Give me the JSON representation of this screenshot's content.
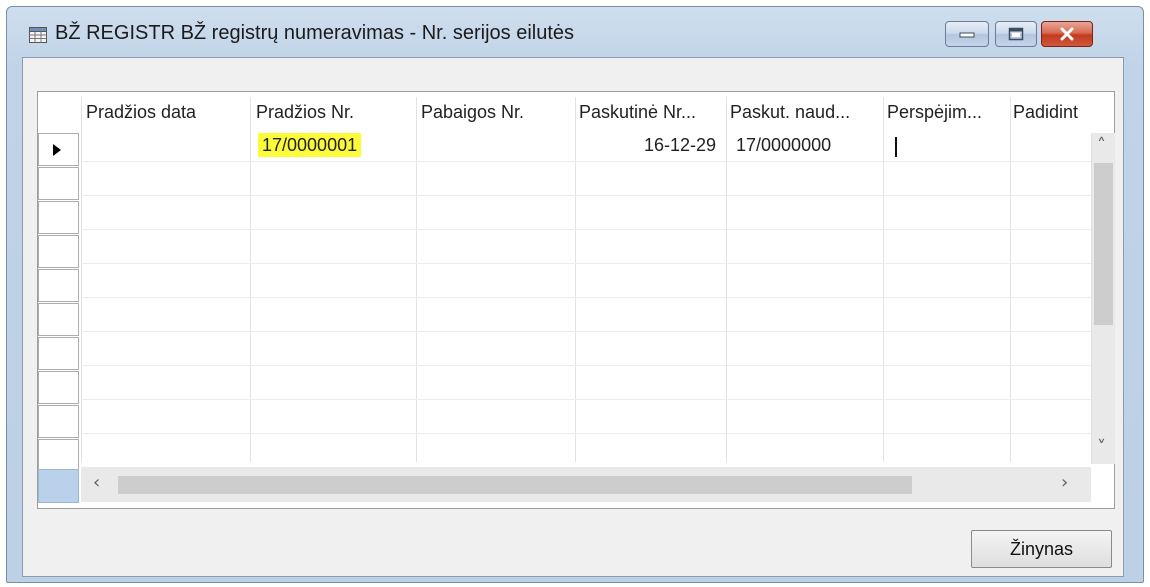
{
  "window": {
    "title": "BŽ REGISTR BŽ registrų numeravimas - Nr. serijos eilutės",
    "controls": {
      "minimize": "minimize",
      "maximize": "maximize",
      "close": "close"
    }
  },
  "table": {
    "columns": [
      "Pradžios data",
      "Pradžios Nr.",
      "Pabaigos Nr.",
      "Paskutinė Nr...",
      "Paskut. naud...",
      "Perspėjim...",
      "Padidint"
    ],
    "rows": [
      {
        "pradzios_data": "",
        "pradzios_nr": "17/0000001",
        "pabaigos_nr": "",
        "paskutine_nr": "16-12-29",
        "paskut_naud": "17/0000000",
        "perspejim": "",
        "padidint": ""
      }
    ],
    "highlight_color": "#fcfb3a"
  },
  "footer": {
    "button_label": "Žinynas"
  }
}
